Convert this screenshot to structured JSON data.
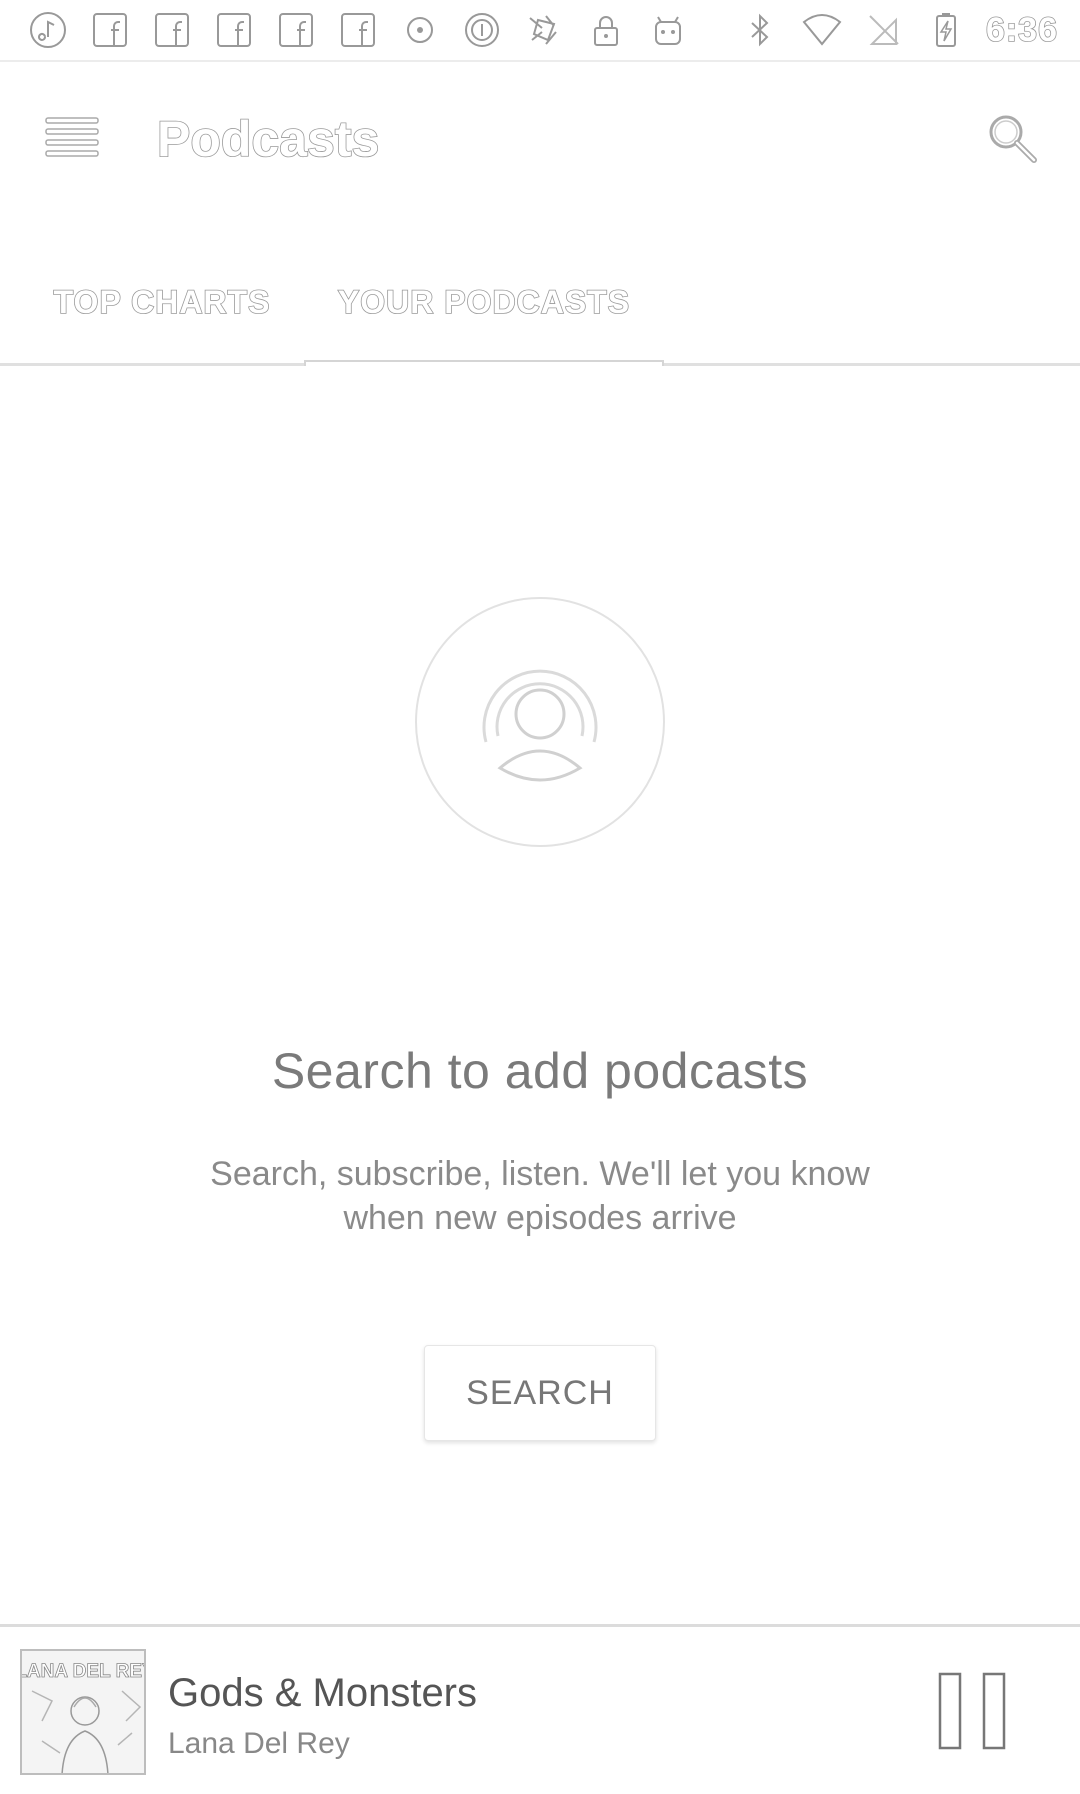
{
  "status_bar": {
    "time": "6:36",
    "left_icons": [
      "music-note-icon",
      "facebook-icon",
      "facebook-icon",
      "facebook-icon",
      "facebook-icon",
      "facebook-icon",
      "dot-icon",
      "circle-i-icon",
      "pinwheel-icon",
      "lock-icon",
      "android-icon"
    ],
    "right_icons": [
      "bluetooth-icon",
      "wifi-icon",
      "no-sim-icon",
      "battery-charging-icon"
    ]
  },
  "app_bar": {
    "title": "Podcasts",
    "menu_icon": "menu-icon",
    "search_icon": "search-icon"
  },
  "tabs": [
    {
      "label": "TOP CHARTS",
      "selected": false
    },
    {
      "label": "YOUR PODCASTS",
      "selected": true
    }
  ],
  "empty_state": {
    "icon": "podcast-icon",
    "title": "Search to add podcasts",
    "subtitle": "Search, subscribe, listen. We'll let you know when new episodes arrive",
    "button_label": "SEARCH"
  },
  "now_playing": {
    "album_art_text": "LANA DEL REY",
    "title": "Gods & Monsters",
    "artist": "Lana Del Rey",
    "control_icon": "pause-icon"
  }
}
